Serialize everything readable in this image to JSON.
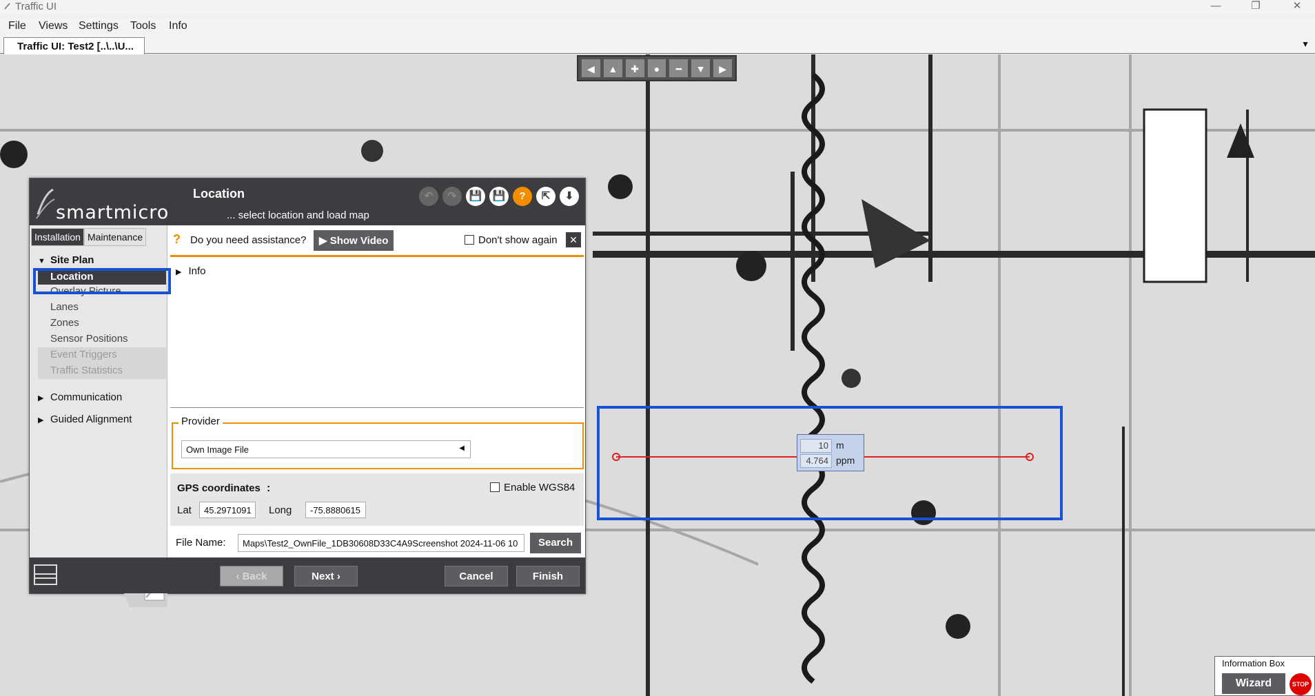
{
  "window": {
    "title": "Traffic UI",
    "minimize": "—",
    "restore": "❐",
    "close": "✕"
  },
  "menu": [
    "File",
    "Views",
    "Settings",
    "Tools",
    "Info"
  ],
  "tab": {
    "label": "Traffic UI: Test2 [..\\..\\U..."
  },
  "navbar": [
    "◀",
    "▲",
    "✚",
    "●",
    "━",
    "▼",
    "▶"
  ],
  "measure": {
    "distance": "10",
    "distance_unit": "m",
    "scale": "4.764",
    "scale_unit": "ppm"
  },
  "dialog": {
    "brand": "smartmicro",
    "title": "Location",
    "subtitle": "... select location and load map",
    "header_icons": [
      "↶",
      "↷",
      "💾",
      "💾",
      "?",
      "⇱",
      "⬇"
    ],
    "tabs": [
      "Installation",
      "Maintenance"
    ],
    "tree": {
      "site_plan": "Site Plan",
      "items": [
        "Location",
        "Overlay Picture",
        "Lanes",
        "Zones",
        "Sensor Positions",
        "Event Triggers",
        "Traffic Statistics"
      ],
      "communication": "Communication",
      "guided_alignment": "Guided Alignment"
    },
    "assist": {
      "question": "Do you need assistance?",
      "show_video": "Show Video",
      "dont_show": "Don't show again",
      "close": "✕"
    },
    "info": "Info",
    "provider": {
      "legend": "Provider",
      "value": "Own Image File"
    },
    "gps": {
      "label": "GPS coordinates",
      "colon": ":",
      "enable_wgs84": "Enable WGS84",
      "lat_label": "Lat",
      "lat": "45.2971091",
      "long_label": "Long",
      "long": "-75.8880615"
    },
    "file": {
      "label": "File Name:",
      "value": "Maps\\Test2_OwnFile_1DB30608D33C4A9Screenshot 2024-11-06 10",
      "search": "Search"
    },
    "footer": {
      "back": "Back",
      "next": "Next",
      "cancel": "Cancel",
      "finish": "Finish"
    }
  },
  "infobox": {
    "title": "Information Box",
    "wizard": "Wizard",
    "stop": "STOP"
  },
  "colors": {
    "accent": "#f28c00",
    "highlight": "#1652d8",
    "dark": "#3b3d40",
    "measure_line": "#e02020"
  }
}
